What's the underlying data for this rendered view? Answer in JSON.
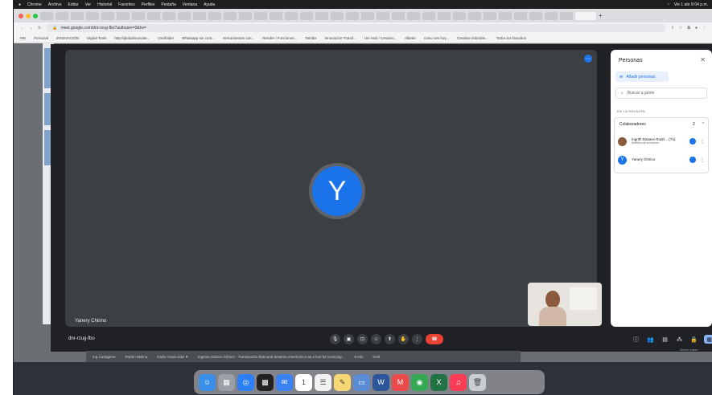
{
  "menubar": {
    "items": [
      "Chrome",
      "Archivo",
      "Editar",
      "Ver",
      "Historial",
      "Favoritos",
      "Perfiles",
      "Pestaña",
      "Ventana",
      "Ayuda"
    ],
    "clock": "Vie 1 abr 8:04 p.m."
  },
  "browser": {
    "url": "meet.google.com/dnr-rzug-fbo?authuser=0&hs=",
    "bookmarks": [
      "MG",
      "Personal",
      "INNOVACIÓN",
      "Digital Tools",
      "http://globalinnovate...",
      "Onefolder",
      "Whatsapp sin cont...",
      "Herramientas can...",
      "Render / Funciones...",
      "Tambix",
      "Innovación Transf...",
      "Uni Hub / Creativo...",
      "elbedo",
      "como ves hoy...",
      "Creative industrie...",
      "Todos los favoritos"
    ]
  },
  "stage": {
    "avatar_letter": "Y",
    "tile_name": "Yanery Chirino"
  },
  "panel": {
    "title": "Personas",
    "close_glyph": "✕",
    "add_people_label": "Añadir personas",
    "search_placeholder": "Buscar a gente",
    "section_label": "EN LA REUNIÓN",
    "collab_label": "Colaboradores",
    "collab_count": "2",
    "people": [
      {
        "name": "Ingrith Dasaev Rodrí... (Tú)",
        "sub": "Anfitrión de la reunión",
        "avatar_letter": "",
        "avatar_color": "#8a5a3c"
      },
      {
        "name": "Yanery Chirino",
        "sub": "",
        "avatar_letter": "Y",
        "avatar_color": "#1a73e8"
      }
    ]
  },
  "bottom": {
    "meeting_code": "dnr-rzug-fbo",
    "right_caption": "Diseño cuadro"
  },
  "controls": [
    {
      "name": "mic-icon",
      "glyph": "🎙"
    },
    {
      "name": "camera-icon",
      "glyph": "▣"
    },
    {
      "name": "captions-icon",
      "glyph": "⊡"
    },
    {
      "name": "emoji-icon",
      "glyph": "☺"
    },
    {
      "name": "present-icon",
      "glyph": "⬆"
    },
    {
      "name": "raise-hand-icon",
      "glyph": "✋"
    },
    {
      "name": "more-options-icon",
      "glyph": "⋮"
    },
    {
      "name": "end-call-icon",
      "glyph": "☎"
    }
  ],
  "right_controls": [
    {
      "name": "info-icon",
      "glyph": "ⓘ"
    },
    {
      "name": "people-icon",
      "glyph": "👥"
    },
    {
      "name": "chat-icon",
      "glyph": "▤"
    },
    {
      "name": "activities-icon",
      "glyph": "⁂"
    },
    {
      "name": "host-controls-icon",
      "glyph": "🔒"
    },
    {
      "name": "side-panel-icon",
      "glyph": "▦"
    }
  ],
  "background_strip": [
    "Ing Cartagena",
    "Rubén Molina",
    "Karlie Anais Diaz R",
    "Ingenia Suárez Gómez - Transacción Bancaria Sistema mnemónico as a tool for invoicing...",
    "6 min",
    "0:00"
  ],
  "colors": {
    "accent": "#1a73e8",
    "end_call": "#ea4335",
    "meet_bg": "#202124",
    "stage_bg": "#3c4043"
  },
  "dock_apps": [
    {
      "name": "finder-icon",
      "color": "#3c8fe8",
      "glyph": "☺"
    },
    {
      "name": "launchpad-icon",
      "color": "#9aa0a6",
      "glyph": "▦"
    },
    {
      "name": "safari-icon",
      "color": "#2d7ff9",
      "glyph": "◎"
    },
    {
      "name": "mission-control-icon",
      "color": "#222222",
      "glyph": "▩"
    },
    {
      "name": "mail-icon",
      "color": "#3b82f6",
      "glyph": "✉"
    },
    {
      "name": "calendar-icon",
      "color": "#ffffff",
      "glyph": "1"
    },
    {
      "name": "reminders-icon",
      "color": "#f2f2f2",
      "glyph": "☰"
    },
    {
      "name": "notes-icon",
      "color": "#f7d774",
      "glyph": "✎"
    },
    {
      "name": "preview-icon",
      "color": "#5a8dd6",
      "glyph": "▭"
    },
    {
      "name": "word-icon",
      "color": "#2b579a",
      "glyph": "W"
    },
    {
      "name": "miro-icon",
      "color": "#ea4a4a",
      "glyph": "M"
    },
    {
      "name": "chrome-icon",
      "color": "#34a853",
      "glyph": "◉"
    },
    {
      "name": "excel-icon",
      "color": "#217346",
      "glyph": "X"
    },
    {
      "name": "music-icon",
      "color": "#fa3c55",
      "glyph": "♫"
    },
    {
      "name": "trash-icon",
      "color": "#c9ccd1",
      "glyph": "🗑"
    }
  ]
}
